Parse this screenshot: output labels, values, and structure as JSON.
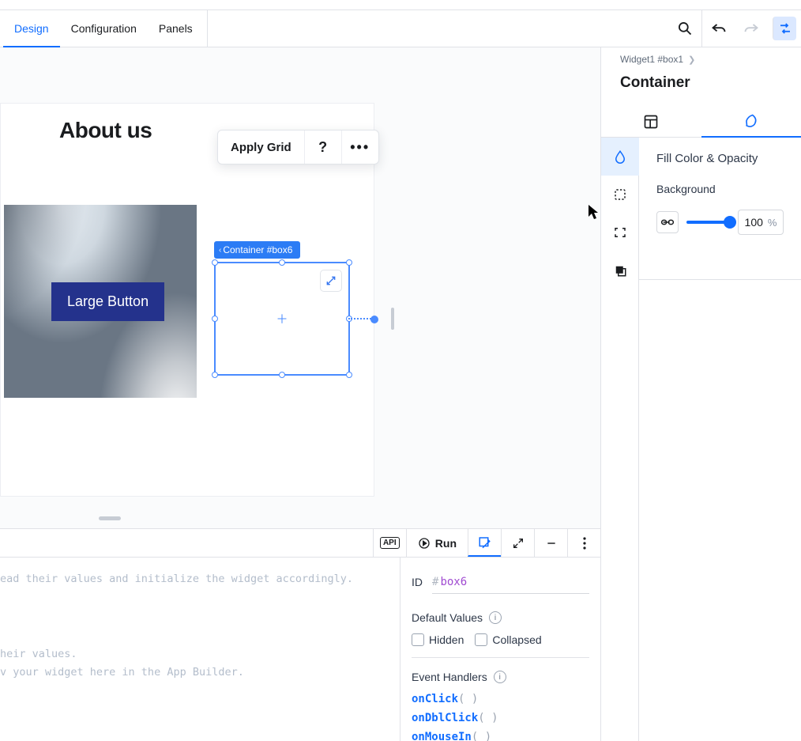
{
  "topbar": {
    "tabs": [
      "Design",
      "Configuration",
      "Panels"
    ],
    "activeTab": 0
  },
  "inspector": {
    "breadcrumb": "Widget1 #box1",
    "title": "Container",
    "section_title": "Fill Color & Opacity",
    "background_label": "Background",
    "opacity_value": "100",
    "opacity_unit": "%"
  },
  "stage": {
    "page_heading": "About us",
    "large_button_label": "Large Button",
    "selected_tag": "Container #box6",
    "context_toolbar": {
      "apply_grid": "Apply Grid"
    }
  },
  "dev": {
    "run_label": "Run",
    "api_label": "API",
    "code_lines": [
      "ead their values and initialize the widget accordingly.",
      "",
      "",
      "",
      "heir values.",
      "v your widget here in the App Builder."
    ],
    "props": {
      "id_label": "ID",
      "id_value": "box6",
      "defaults_title": "Default Values",
      "hidden_label": "Hidden",
      "collapsed_label": "Collapsed",
      "handlers_title": "Event Handlers",
      "handlers": [
        "onClick",
        "onDblClick",
        "onMouseIn"
      ]
    }
  }
}
